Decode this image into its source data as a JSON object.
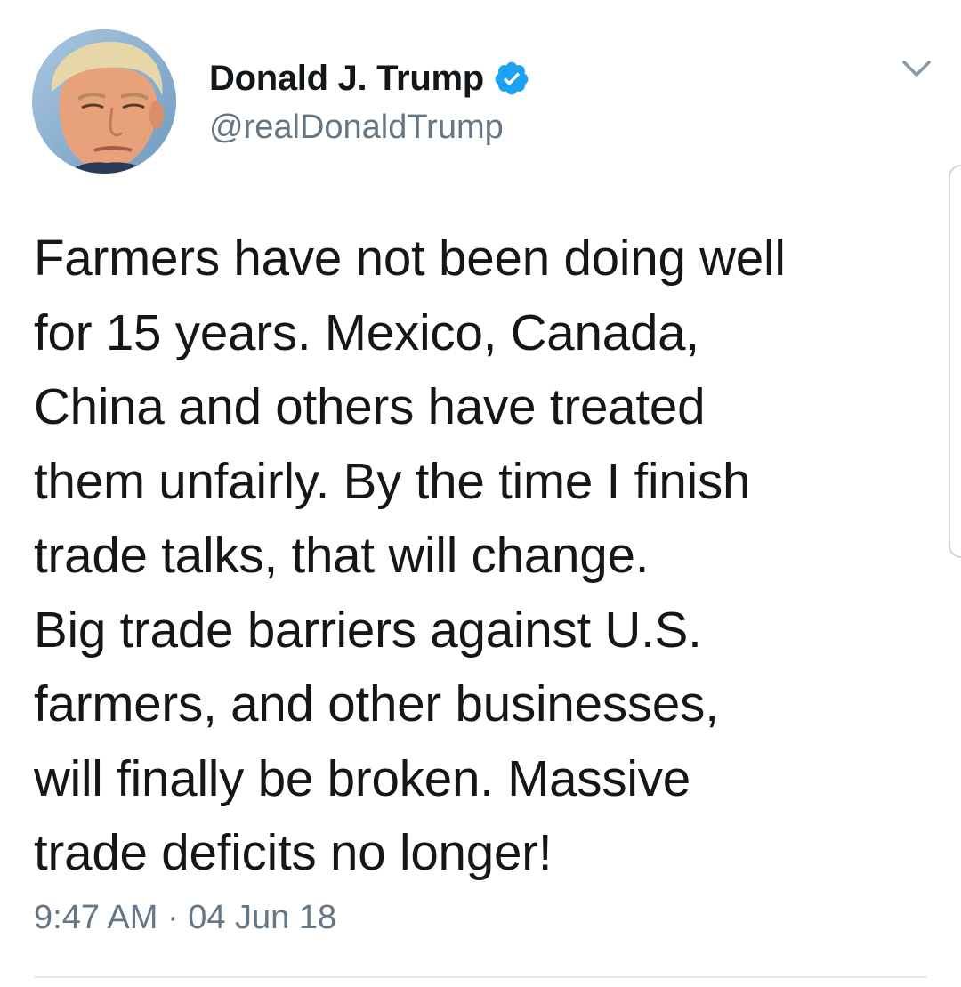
{
  "user": {
    "display_name": "Donald J. Trump",
    "handle": "@realDonaldTrump",
    "verified": true,
    "avatar_icon": "profile-photo"
  },
  "tweet": {
    "text": "Farmers have not been doing well\nfor 15 years. Mexico, Canada,\nChina and others have treated\nthem unfairly. By the time I finish\ntrade talks, that will change.\nBig trade barriers against U.S.\nfarmers, and other businesses,\nwill finally be broken. Massive\ntrade deficits no longer!",
    "timestamp": "9:47 AM · 04 Jun 18"
  },
  "icons": {
    "verified": "verified-badge-icon",
    "menu": "chevron-down-icon"
  },
  "colors": {
    "verified_blue": "#1da1f2",
    "secondary_text": "#657786",
    "primary_text": "#14171a",
    "divider": "#e6ecf0"
  }
}
